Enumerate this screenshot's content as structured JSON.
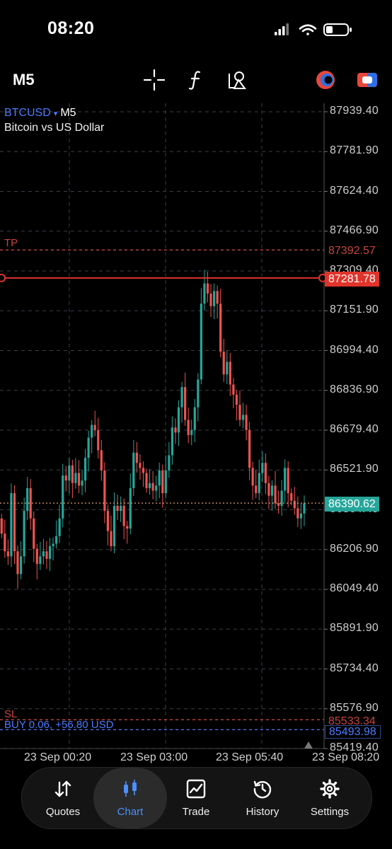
{
  "status": {
    "time": "08:20"
  },
  "toolbar": {
    "timeframe": "M5",
    "icons": [
      "crosshair-icon",
      "function-icon",
      "objects-icon",
      "trade-mode-icon",
      "one-click-trading-icon"
    ]
  },
  "symbol": {
    "name": "BTCUSD",
    "caret": "▾",
    "timeframe": "M5",
    "description": "Bitcoin vs US Dollar"
  },
  "price_axis": [
    "87939.40",
    "87781.90",
    "87624.40",
    "87466.90",
    "87309.40",
    "87151.90",
    "86994.40",
    "86836.90",
    "86679.40",
    "86521.90",
    "86364.40",
    "86206.90",
    "86049.40",
    "85891.90",
    "85734.40",
    "85576.90",
    "85419.40"
  ],
  "levels": {
    "tp_label": "TP",
    "tp_price": "87392.57",
    "entry_price": "87281.78",
    "current_price": "86390.62",
    "sl_label": "SL",
    "sl_price": "85533.34",
    "position_label": "BUY 0.06, +56.80 USD",
    "position_price": "85493.98"
  },
  "time_axis": [
    "23 Sep 00:20",
    "23 Sep 03:00",
    "23 Sep 05:40",
    "23 Sep 08:20"
  ],
  "colors": {
    "bull": "#26a69a",
    "bear": "#ef5350",
    "tp_sl": "#c6463d",
    "entry": "#e0342b",
    "bid": "#26a69a",
    "accent": "#4a90ff"
  },
  "chart_data": {
    "type": "candlestick",
    "title": "BTCUSD, M5",
    "ylim": [
      85419.4,
      88000
    ],
    "x_labels": [
      "23 Sep 00:20",
      "23 Sep 03:00",
      "23 Sep 05:40",
      "23 Sep 08:20"
    ],
    "ohlc_close": [
      86270,
      86200,
      86180,
      86430,
      86200,
      86110,
      86180,
      86360,
      86450,
      86330,
      86210,
      86150,
      86180,
      86200,
      86170,
      86220,
      86230,
      86260,
      86330,
      86500,
      86480,
      86540,
      86470,
      86510,
      86460,
      86480,
      86570,
      86650,
      86700,
      86680,
      86600,
      86520,
      86360,
      86280,
      86220,
      86380,
      86360,
      86380,
      86300,
      86290,
      86450,
      86590,
      86550,
      86530,
      86510,
      86450,
      86470,
      86440,
      86460,
      86520,
      86430,
      86520,
      86580,
      86690,
      86670,
      86770,
      86850,
      86720,
      86660,
      86680,
      86770,
      86880,
      87180,
      87260,
      87220,
      87170,
      87230,
      87180,
      86990,
      86900,
      86950,
      86860,
      86820,
      86780,
      86720,
      86740,
      86680,
      86530,
      86460,
      86430,
      86510,
      86550,
      86470,
      86420,
      86460,
      86390,
      86380,
      86440,
      86530,
      86430,
      86400,
      86370,
      86330,
      86350,
      86390
    ]
  },
  "nav": {
    "items": [
      {
        "label": "Quotes",
        "icon": "quotes-icon"
      },
      {
        "label": "Chart",
        "icon": "chart-icon"
      },
      {
        "label": "Trade",
        "icon": "trade-icon"
      },
      {
        "label": "History",
        "icon": "history-icon"
      },
      {
        "label": "Settings",
        "icon": "settings-icon"
      }
    ],
    "active": "Chart"
  }
}
